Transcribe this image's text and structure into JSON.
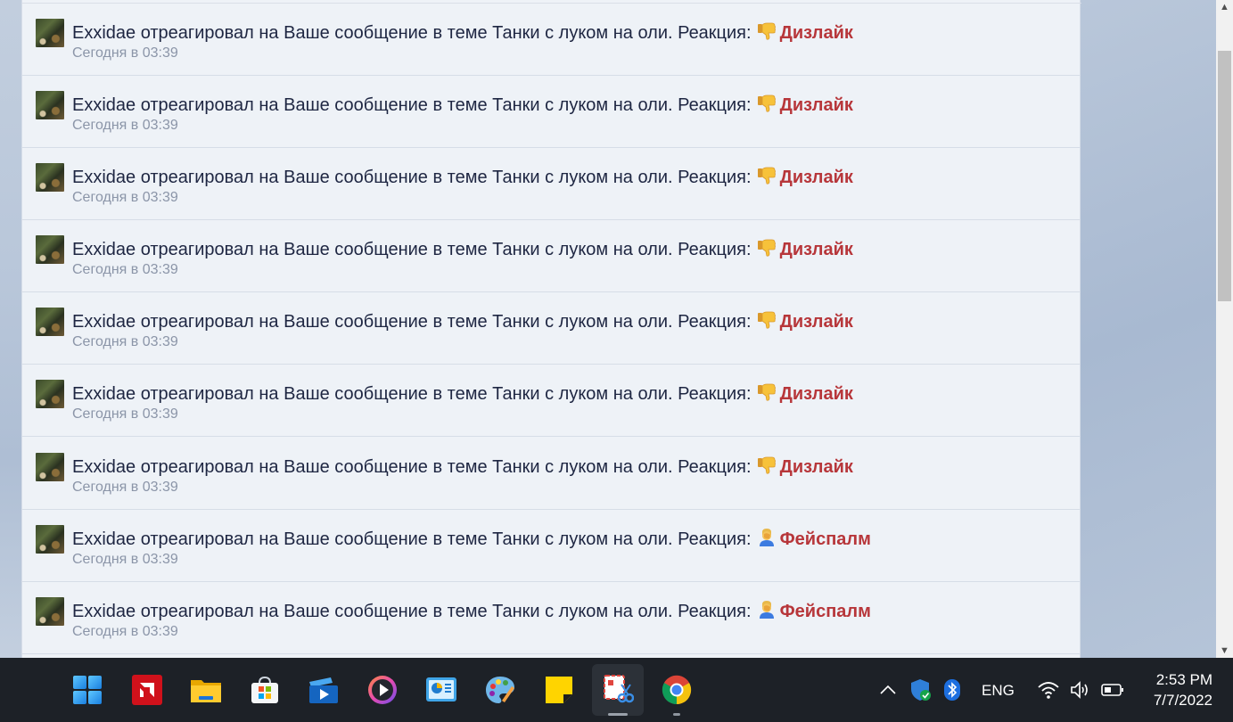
{
  "alerts": [
    {
      "text": "Exxidae отреагировал на Ваше сообщение в теме Танки с луком на оли. Реакция:",
      "reaction": "Дизлайк",
      "reaction_icon": "thumbs-down-icon",
      "time": "Сегодня в 03:39"
    },
    {
      "text": "Exxidae отреагировал на Ваше сообщение в теме Танки с луком на оли. Реакция:",
      "reaction": "Дизлайк",
      "reaction_icon": "thumbs-down-icon",
      "time": "Сегодня в 03:39"
    },
    {
      "text": "Exxidae отреагировал на Ваше сообщение в теме Танки с луком на оли. Реакция:",
      "reaction": "Дизлайк",
      "reaction_icon": "thumbs-down-icon",
      "time": "Сегодня в 03:39"
    },
    {
      "text": "Exxidae отреагировал на Ваше сообщение в теме Танки с луком на оли. Реакция:",
      "reaction": "Дизлайк",
      "reaction_icon": "thumbs-down-icon",
      "time": "Сегодня в 03:39"
    },
    {
      "text": "Exxidae отреагировал на Ваше сообщение в теме Танки с луком на оли. Реакция:",
      "reaction": "Дизлайк",
      "reaction_icon": "thumbs-down-icon",
      "time": "Сегодня в 03:39"
    },
    {
      "text": "Exxidae отреагировал на Ваше сообщение в теме Танки с луком на оли. Реакция:",
      "reaction": "Дизлайк",
      "reaction_icon": "thumbs-down-icon",
      "time": "Сегодня в 03:39"
    },
    {
      "text": "Exxidae отреагировал на Ваше сообщение в теме Танки с луком на оли. Реакция:",
      "reaction": "Дизлайк",
      "reaction_icon": "thumbs-down-icon",
      "time": "Сегодня в 03:39"
    },
    {
      "text": "Exxidae отреагировал на Ваше сообщение в теме Танки с луком на оли. Реакция:",
      "reaction": "Фейспалм",
      "reaction_icon": "facepalm-icon",
      "time": "Сегодня в 03:39"
    },
    {
      "text": "Exxidae отреагировал на Ваше сообщение в теме Танки с луком на оли. Реакция:",
      "reaction": "Фейспалм",
      "reaction_icon": "facepalm-icon",
      "time": "Сегодня в 03:39"
    }
  ],
  "colors": {
    "reaction_text": "#b7363a",
    "alert_text": "#1e2642",
    "time_text": "#8b95a8",
    "panel_bg": "#eef2f7",
    "taskbar_bg": "#1d2127"
  },
  "taskbar": {
    "apps": [
      "windows-start-icon",
      "amd-software-icon",
      "file-explorer-icon",
      "microsoft-store-icon",
      "movies-tv-icon",
      "media-player-icon",
      "control-panel-icon",
      "paint-icon",
      "sticky-notes-icon",
      "snipping-tool-icon",
      "chrome-icon"
    ],
    "active_app": "snipping-tool-icon",
    "tray": {
      "language": "ENG",
      "time": "2:53 PM",
      "date": "7/7/2022"
    }
  }
}
